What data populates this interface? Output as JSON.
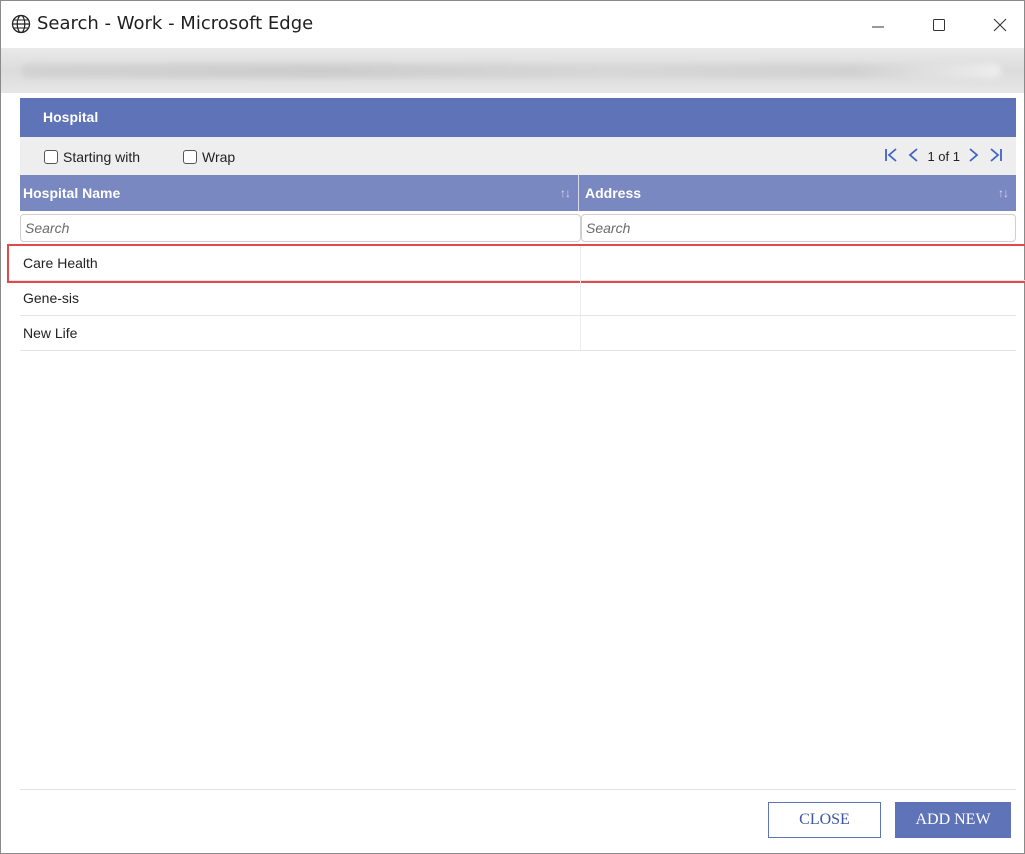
{
  "window": {
    "title": "Search - Work - Microsoft Edge",
    "icon": "globe-icon"
  },
  "panel": {
    "title": "Hospital"
  },
  "toolbar": {
    "starting_with_label": "Starting with",
    "wrap_label": "Wrap",
    "pager_text": "1 of 1"
  },
  "columns": {
    "name_label": "Hospital Name",
    "address_label": "Address",
    "sort_glyph": "↑↓"
  },
  "filters": {
    "name_placeholder": "Search",
    "address_placeholder": "Search"
  },
  "rows": [
    {
      "name": "Care Health",
      "address": ""
    },
    {
      "name": "Gene-sis",
      "address": ""
    },
    {
      "name": "New Life",
      "address": ""
    }
  ],
  "buttons": {
    "close_label": "CLOSE",
    "add_new_label": "ADD NEW"
  },
  "colors": {
    "header_blue": "#5f73b8",
    "column_header_blue": "#7a88c2",
    "selection_red": "#e04a4a",
    "pager_blue": "#3f63c6"
  }
}
